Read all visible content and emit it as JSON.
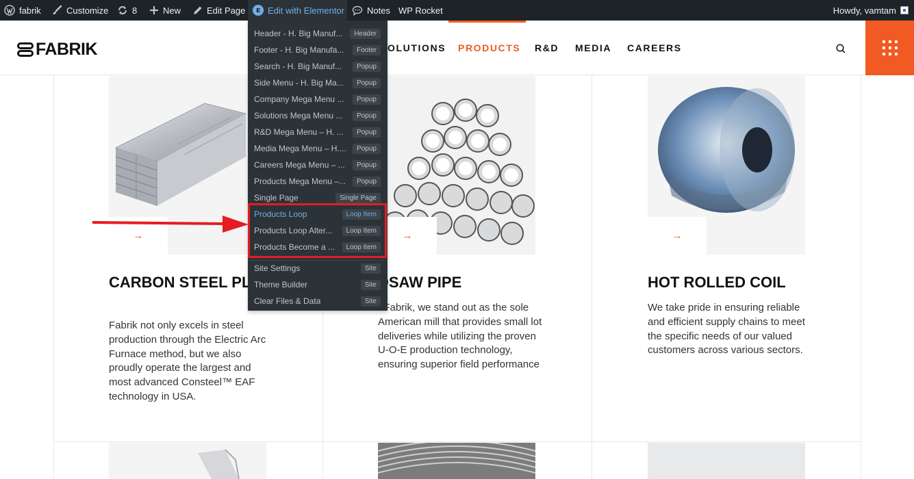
{
  "admin_bar": {
    "site": "fabrik",
    "customize": "Customize",
    "updates": "8",
    "new": "New",
    "edit_page": "Edit Page",
    "elementor": "Edit with Elementor",
    "notes": "Notes",
    "wp_rocket": "WP Rocket",
    "howdy": "Howdy, vamtam"
  },
  "header": {
    "logo": "FABRIK",
    "nav": [
      "OLUTIONS",
      "PRODUCTS",
      "R&D",
      "MEDIA",
      "CAREERS"
    ],
    "active_nav": "PRODUCTS",
    "accent_color": "#f15a22"
  },
  "elementor_menu": {
    "items": [
      {
        "label": "Header - H. Big Manuf...",
        "badge": "Header"
      },
      {
        "label": "Footer - H. Big Manufa...",
        "badge": "Footer"
      },
      {
        "label": "Search - H. Big Manuf...",
        "badge": "Popup"
      },
      {
        "label": "Side Menu - H. Big Ma...",
        "badge": "Popup"
      },
      {
        "label": "Company Mega Menu ...",
        "badge": "Popup"
      },
      {
        "label": "Solutions Mega Menu ...",
        "badge": "Popup"
      },
      {
        "label": "R&D Mega Menu – H. ...",
        "badge": "Popup"
      },
      {
        "label": "Media Mega Menu – H....",
        "badge": "Popup"
      },
      {
        "label": "Careers Mega Menu – ...",
        "badge": "Popup"
      },
      {
        "label": "Products Mega Menu –...",
        "badge": "Popup"
      },
      {
        "label": "Single Page",
        "badge": "Single Page"
      },
      {
        "label": "Products Loop",
        "badge": "Loop Item"
      },
      {
        "label": "Products Loop Alter...",
        "badge": "Loop Item"
      },
      {
        "label": "Products Become a ...",
        "badge": "Loop Item"
      }
    ],
    "site_items": [
      {
        "label": "Site Settings",
        "badge": "Site"
      },
      {
        "label": "Theme Builder",
        "badge": "Site"
      },
      {
        "label": "Clear Files & Data",
        "badge": "Site"
      }
    ]
  },
  "products": [
    {
      "title": "CARBON STEEL PLATE",
      "desc": "Fabrik not only excels in steel production through the Electric Arc Furnace method, but we also proudly operate the largest and most advanced Consteel™ EAF technology in USA.",
      "arrow": "→"
    },
    {
      "title": "DSAW PIPE",
      "desc": "t Fabrik, we stand out as the sole American mill that provides small lot deliveries while utilizing the proven U-O-E production technology, ensuring superior field performance",
      "arrow": "→"
    },
    {
      "title": "HOT ROLLED COIL",
      "desc": "We take pride in ensuring reliable and efficient supply chains to meet the specific needs of our valued customers across various sectors.",
      "arrow": "→"
    }
  ]
}
